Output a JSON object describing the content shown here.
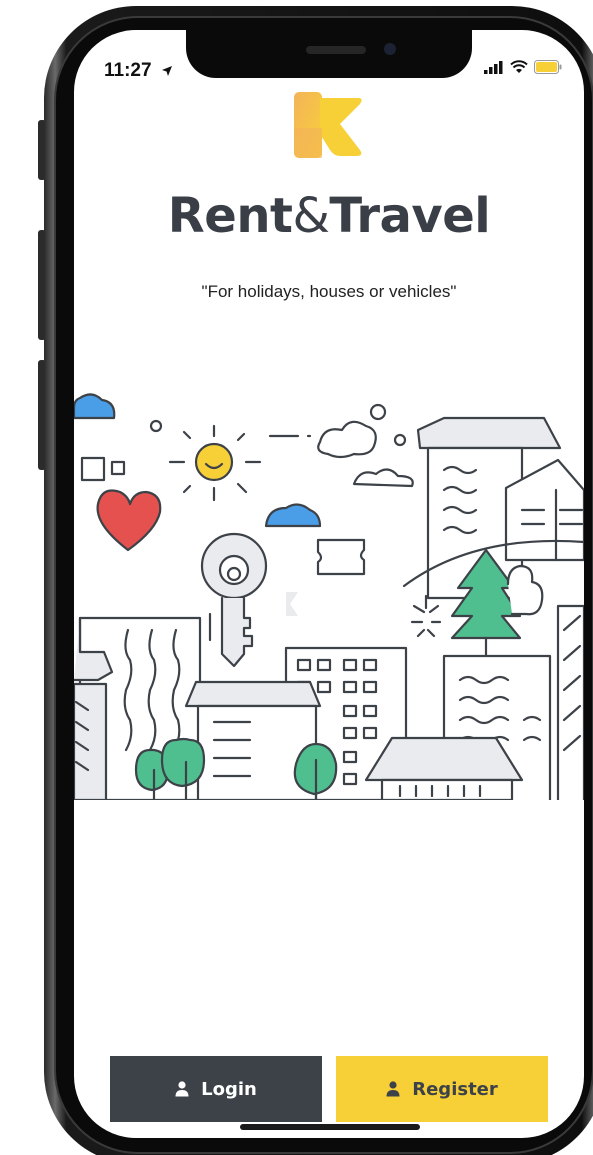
{
  "status_bar": {
    "time": "11:27",
    "location_icon": "location-arrow-icon",
    "signal_icon": "cellular-signal-icon",
    "wifi_icon": "wifi-icon",
    "battery_icon": "battery-icon",
    "battery_color": "#f7d038"
  },
  "app": {
    "logo_icon": "rent-and-travel-logo",
    "brand_part1": "Rent",
    "brand_amp": "&",
    "brand_part2": "Travel",
    "tagline": "\"For holidays, houses or vehicles\""
  },
  "illustration": {
    "icon": "city-illustration"
  },
  "actions": {
    "login_label": "Login",
    "register_label": "Register",
    "user_icon": "user-icon"
  },
  "colors": {
    "accent": "#f7d038",
    "dark": "#3d4249",
    "heart": "#e5514f",
    "tree": "#4fbf8f",
    "cloud": "#4a9ee8",
    "sun": "#f7d038"
  }
}
